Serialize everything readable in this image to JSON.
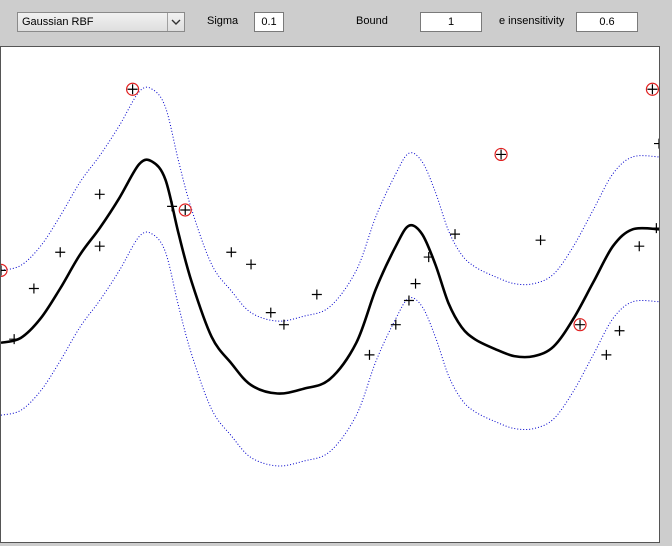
{
  "toolbar": {
    "kernel": {
      "selected": "Gaussian RBF",
      "icon": "chevron-down-icon"
    },
    "sigma": {
      "label": "Sigma",
      "value": "0.1"
    },
    "bound": {
      "label": "Bound",
      "value": "1"
    },
    "epsilon": {
      "label": "e insensitivity",
      "value": "0.6"
    }
  },
  "chart_data": {
    "type": "scatter",
    "xlim": [
      0,
      1
    ],
    "ylim": [
      -2.2,
      1.9
    ],
    "grid": false,
    "colors": {
      "regression": "#000000",
      "tube": "#0000cc",
      "points": "#000000",
      "support_vectors": "#e02020"
    },
    "series": [
      {
        "kind": "line",
        "x": [
          0.0,
          0.03,
          0.06,
          0.09,
          0.12,
          0.15,
          0.18,
          0.21,
          0.23,
          0.25,
          0.27,
          0.29,
          0.32,
          0.35,
          0.38,
          0.42,
          0.46,
          0.5,
          0.54,
          0.57,
          0.6,
          0.62,
          0.64,
          0.66,
          0.68,
          0.7,
          0.72,
          0.75,
          0.78,
          0.81,
          0.84,
          0.87,
          0.9,
          0.93,
          0.96,
          1.0
        ],
        "y": [
          -0.55,
          -0.51,
          -0.35,
          -0.1,
          0.18,
          0.4,
          0.65,
          0.93,
          0.95,
          0.8,
          0.35,
          -0.05,
          -0.5,
          -0.72,
          -0.9,
          -0.97,
          -0.93,
          -0.85,
          -0.55,
          -0.1,
          0.25,
          0.42,
          0.35,
          0.1,
          -0.22,
          -0.42,
          -0.52,
          -0.6,
          -0.66,
          -0.66,
          -0.58,
          -0.35,
          -0.05,
          0.25,
          0.39,
          0.39
        ]
      },
      {
        "kind": "dotted-line",
        "x": [
          0.0,
          0.03,
          0.06,
          0.09,
          0.12,
          0.15,
          0.18,
          0.21,
          0.23,
          0.25,
          0.27,
          0.29,
          0.32,
          0.35,
          0.38,
          0.42,
          0.46,
          0.5,
          0.54,
          0.57,
          0.6,
          0.62,
          0.64,
          0.66,
          0.68,
          0.7,
          0.72,
          0.75,
          0.78,
          0.81,
          0.84,
          0.87,
          0.9,
          0.93,
          0.96,
          1.0
        ],
        "y": [
          0.05,
          0.09,
          0.25,
          0.5,
          0.78,
          1.0,
          1.25,
          1.53,
          1.55,
          1.4,
          0.95,
          0.55,
          0.1,
          -0.12,
          -0.3,
          -0.37,
          -0.33,
          -0.25,
          0.05,
          0.5,
          0.85,
          1.02,
          0.95,
          0.7,
          0.38,
          0.18,
          0.08,
          0.0,
          -0.06,
          -0.06,
          0.02,
          0.25,
          0.55,
          0.85,
          0.99,
          0.99
        ]
      },
      {
        "kind": "dotted-line",
        "x": [
          0.0,
          0.03,
          0.06,
          0.09,
          0.12,
          0.15,
          0.18,
          0.21,
          0.23,
          0.25,
          0.27,
          0.29,
          0.32,
          0.35,
          0.38,
          0.42,
          0.46,
          0.5,
          0.54,
          0.57,
          0.6,
          0.62,
          0.64,
          0.66,
          0.68,
          0.7,
          0.72,
          0.75,
          0.78,
          0.81,
          0.84,
          0.87,
          0.9,
          0.93,
          0.96,
          1.0
        ],
        "y": [
          -1.15,
          -1.11,
          -0.95,
          -0.7,
          -0.42,
          -0.2,
          0.05,
          0.33,
          0.35,
          0.2,
          -0.25,
          -0.65,
          -1.1,
          -1.32,
          -1.5,
          -1.57,
          -1.53,
          -1.45,
          -1.15,
          -0.7,
          -0.35,
          -0.18,
          -0.25,
          -0.5,
          -0.82,
          -1.02,
          -1.12,
          -1.2,
          -1.26,
          -1.26,
          -1.18,
          -0.95,
          -0.65,
          -0.35,
          -0.21,
          -0.21
        ]
      },
      {
        "kind": "points",
        "x": [
          0.0,
          0.02,
          0.05,
          0.09,
          0.15,
          0.15,
          0.2,
          0.26,
          0.28,
          0.35,
          0.38,
          0.41,
          0.43,
          0.48,
          0.56,
          0.6,
          0.62,
          0.63,
          0.65,
          0.69,
          0.76,
          0.82,
          0.88,
          0.92,
          0.94,
          0.97,
          0.99,
          0.996,
          1.0
        ],
        "y": [
          0.05,
          -0.52,
          -0.1,
          0.2,
          0.25,
          0.68,
          1.55,
          0.58,
          0.55,
          0.2,
          0.1,
          -0.3,
          -0.4,
          -0.15,
          -0.65,
          -0.4,
          -0.2,
          -0.06,
          0.16,
          0.35,
          1.01,
          0.3,
          -0.4,
          -0.65,
          -0.45,
          0.25,
          1.55,
          0.4,
          1.1
        ],
        "support_vector": [
          true,
          false,
          false,
          false,
          false,
          false,
          true,
          false,
          true,
          false,
          false,
          false,
          false,
          false,
          false,
          false,
          false,
          false,
          false,
          false,
          true,
          false,
          true,
          false,
          false,
          false,
          true,
          false,
          false
        ]
      }
    ]
  }
}
